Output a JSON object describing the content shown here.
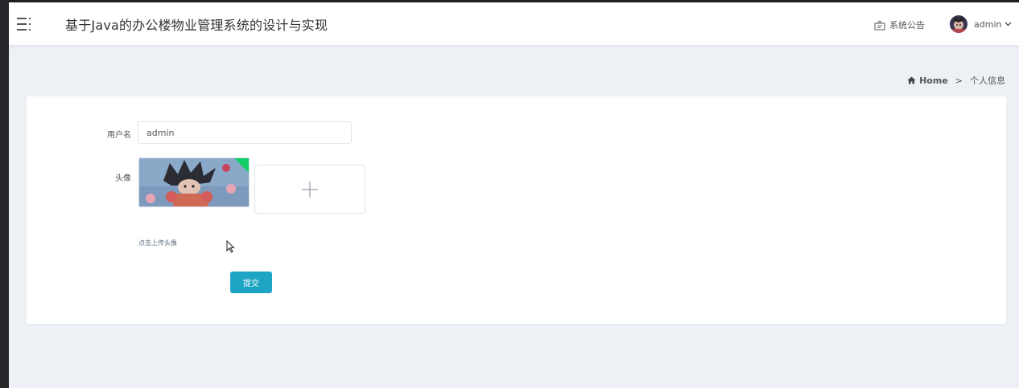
{
  "header": {
    "title": "基于Java的办公楼物业管理系统的设计与实现",
    "notice_label": "系统公告",
    "user_name": "admin"
  },
  "breadcrumb": {
    "home": "Home",
    "separator": ">",
    "current": "个人信息"
  },
  "form": {
    "username_label": "用户名",
    "username_value": "admin",
    "avatar_label": "头像",
    "upload_tip": "点击上传头像",
    "submit_label": "提交"
  },
  "icons": {
    "menu": "hamburger-menu-icon",
    "notice": "notice-board-icon",
    "home": "home-icon",
    "dropdown": "chevron-down-icon",
    "add": "plus-icon",
    "uploaded": "check-icon"
  },
  "colors": {
    "primary_button": "#1fa5c4",
    "page_background": "#edf0f5",
    "upload_success": "#13ce66"
  }
}
